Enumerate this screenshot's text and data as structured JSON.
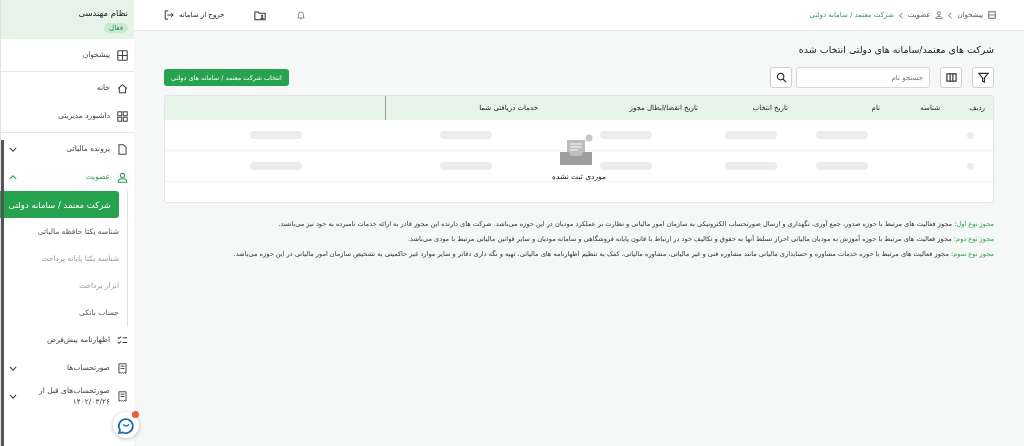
{
  "topbar": {
    "logout": "خروج از سامانه",
    "breadcrumb": [
      {
        "label": "پیشخوان",
        "current": false
      },
      {
        "label": "عضویت",
        "current": false
      },
      {
        "label": "شرکت معتمد / سامانه دولتی",
        "current": true
      }
    ]
  },
  "page": {
    "title": "شرکت های معتمد/سامانه های دولتی انتخاب شده",
    "search": {
      "placeholder": "جستجو نام"
    },
    "select_button": "انتخاب شرکت معتمد / سامانه های دولتی"
  },
  "table": {
    "columns": [
      "ردیف",
      "شناسه",
      "نام",
      "تاریخ انتخاب",
      "تاریخ انقضا/ابطال مجوز",
      "خدمات دریافتی شما"
    ],
    "empty_text": "موردی ثبت نشده"
  },
  "notes": [
    {
      "label": "مجوز نوع اول:",
      "text": "مجوز فعالیت های مرتبط با حوزه صدور، جمع آوری، نگهداری و ارسال صورتحساب الکترونیکی به سازمان امور مالیاتی و نظارت بر عملکرد مودیان در این حوزه می‌باشد. شرکت های دارنده این مجوز قادر به ارائه خدمات نامبرده به خود نیز می‌باشند."
    },
    {
      "label": "مجوز نوع دوم:",
      "text": "مجوز فعالیت های مرتبط با حوزه آموزش به مودیان مالیاتی احراز تسلط آنها به حقوق و تکالیف خود در ارتباط با قانون پایانه فروشگاهی و سامانه مودیان و سایر قوانین مالیاتی مرتبط با مودی می‌باشد."
    },
    {
      "label": "مجوز نوع سوم:",
      "text": "مجوز فعالیت های مرتبط با حوزه خدمات مشاوره و حسابداری مالیاتی مانند مشاوره فنی و غیر مالیاتی، مشاوره مالیاتی، کمک به تنظیم اظهارنامه های مالیاتی، تهیه و نگه داری دفاتر و سایر موارد غیر حاکمیتی به تشخیص سازمان امور مالیاتی در این حوزه می‌باشد."
    }
  ],
  "sidebar": {
    "org": "نظام مهندسی",
    "status": "فعال",
    "sections": [
      {
        "items": [
          {
            "label": "پیشخوان",
            "kind": "link"
          }
        ]
      },
      {
        "items": [
          {
            "label": "خانه",
            "kind": "link"
          },
          {
            "label": "داشبورد مدیریتی",
            "kind": "link"
          }
        ]
      },
      {
        "items": [
          {
            "label": "پرونده مالیاتی",
            "kind": "group",
            "expanded": false
          },
          {
            "label": "عضویت",
            "kind": "group",
            "expanded": true,
            "children": [
              {
                "label": "شرکت معتمد / سامانه دولتی",
                "selected": true,
                "disabled": false
              },
              {
                "label": "شناسه یکتا حافظه مالیاتی",
                "selected": false,
                "disabled": false
              },
              {
                "label": "شناسه یکتا پایانه پرداخت",
                "selected": false,
                "disabled": true
              },
              {
                "label": "ابزار پرداخت",
                "selected": false,
                "disabled": true
              },
              {
                "label": "حساب بانکی",
                "selected": false,
                "disabled": false
              }
            ]
          },
          {
            "label": "اظهارنامه پیش‌فرض",
            "kind": "link"
          },
          {
            "label": "صورتحساب‌ها",
            "kind": "group",
            "expanded": false
          },
          {
            "label": "صورتحساب‌های قبل از ۱۴۰۲/۰۳/۲۶",
            "kind": "group",
            "expanded": false
          }
        ]
      }
    ]
  }
}
